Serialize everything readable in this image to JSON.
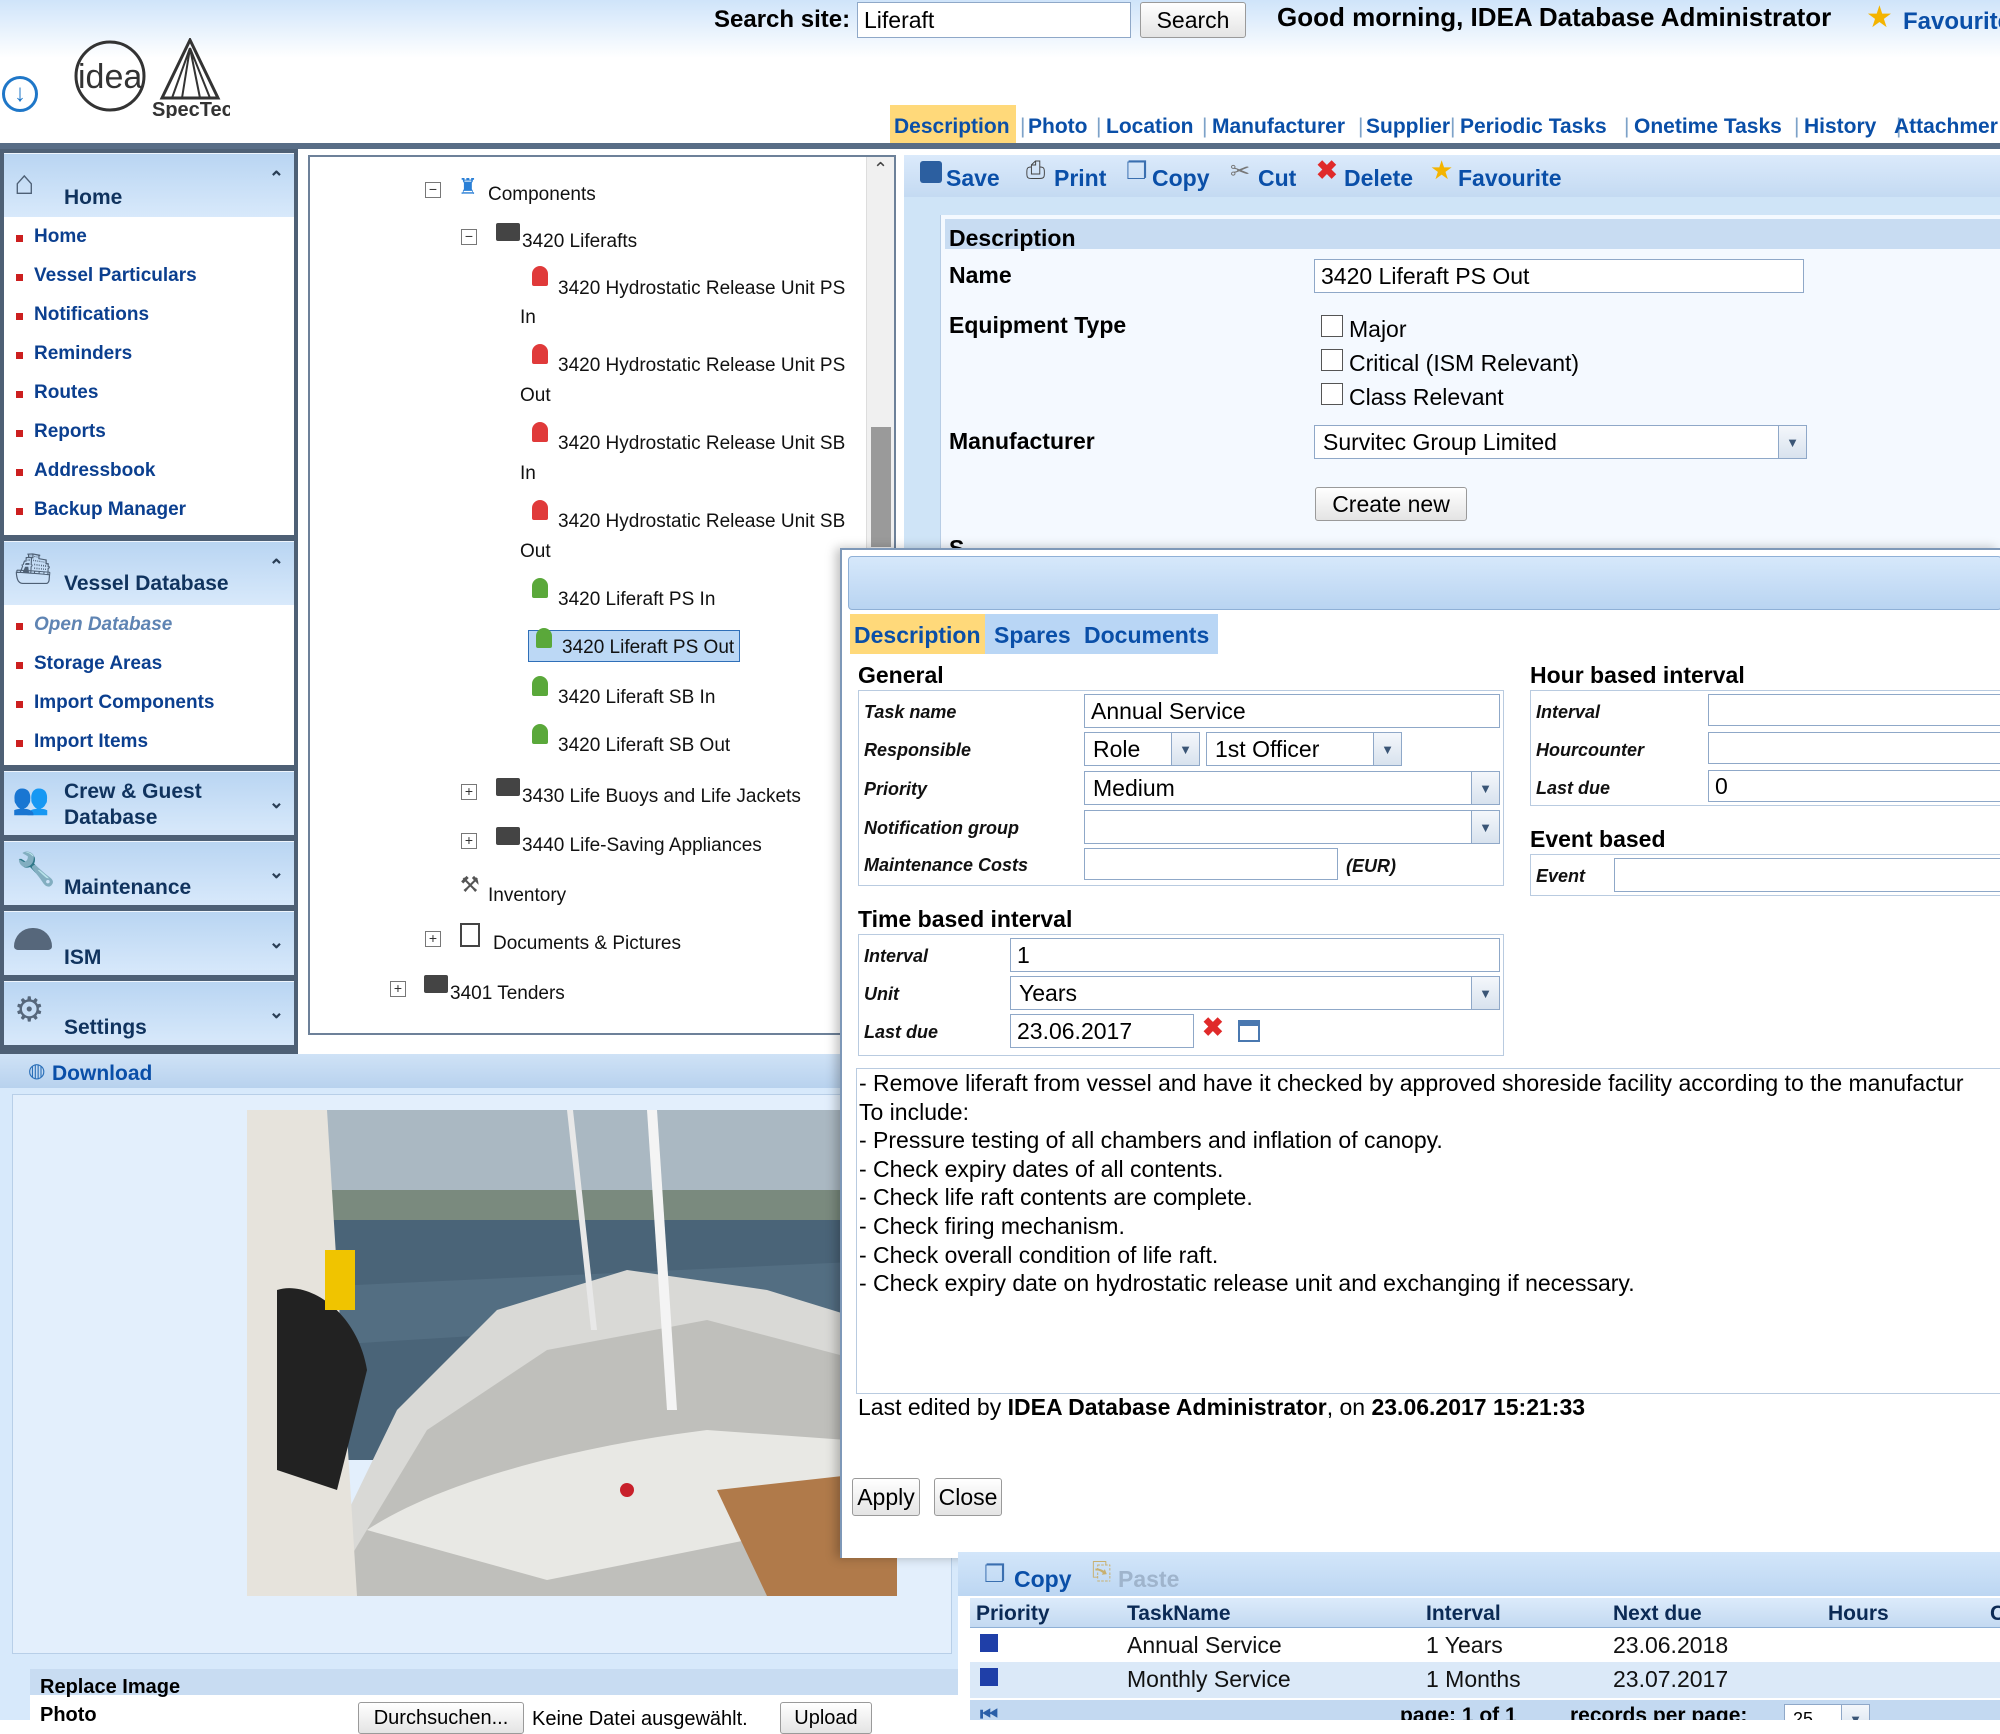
{
  "header": {
    "search_label": "Search site:",
    "search_value": "Liferaft",
    "search_button": "Search",
    "greeting": "Good morning, IDEA Database Administrator",
    "favourites": "Favourite"
  },
  "tabs": [
    "Description",
    "Photo",
    "Location",
    "Manufacturer",
    "Supplier",
    "Periodic Tasks",
    "Onetime Tasks",
    "History",
    "Attachmer"
  ],
  "sidebar": {
    "home": {
      "title": "Home",
      "items": [
        "Home",
        "Vessel Particulars",
        "Notifications",
        "Reminders",
        "Routes",
        "Reports",
        "Addressbook",
        "Backup Manager"
      ]
    },
    "vessel": {
      "title": "Vessel Database",
      "items": [
        "Open Database",
        "Storage Areas",
        "Import Components",
        "Import Items"
      ]
    },
    "crew": {
      "title_line1": "Crew & Guest",
      "title_line2": "Database"
    },
    "maintenance": {
      "title": "Maintenance"
    },
    "ism": {
      "title": "ISM"
    },
    "settings": {
      "title": "Settings"
    }
  },
  "tree": {
    "components": "Components",
    "liferafts": "3420 Liferafts",
    "hru_ps_in_1": "3420 Hydrostatic Release Unit PS",
    "hru_ps_in_2": "In",
    "hru_ps_out_1": "3420 Hydrostatic Release Unit PS",
    "hru_ps_out_2": "Out",
    "hru_sb_in_1": "3420 Hydrostatic Release Unit SB",
    "hru_sb_in_2": "In",
    "hru_sb_out_1": "3420 Hydrostatic Release Unit SB",
    "hru_sb_out_2": "Out",
    "ps_in": "3420 Liferaft PS In",
    "ps_out": "3420 Liferaft PS Out",
    "sb_in": "3420 Liferaft SB In",
    "sb_out": "3420 Liferaft SB Out",
    "buoys": "3430 Life Buoys and Life Jackets",
    "lsa": "3440 Life-Saving Appliances",
    "inventory": "Inventory",
    "docs": "Documents & Pictures",
    "tenders": "3401 Tenders"
  },
  "toolbar": {
    "save": "Save",
    "print": "Print",
    "copy": "Copy",
    "cut": "Cut",
    "delete": "Delete",
    "favourite": "Favourite"
  },
  "description": {
    "section": "Description",
    "name_label": "Name",
    "name_value": "3420 Liferaft PS Out",
    "equip_label": "Equipment Type",
    "major": "Major",
    "critical": "Critical (ISM Relevant)",
    "class_relevant": "Class Relevant",
    "manufacturer_label": "Manufacturer",
    "manufacturer_value": "Survitec Group Limited",
    "create_new": "Create new",
    "supplier_partial": "S"
  },
  "dialog": {
    "tabs": [
      "Description",
      "Spares",
      "Documents"
    ],
    "general": "General",
    "task_name_label": "Task name",
    "task_name_value": "Annual Service",
    "responsible_label": "Responsible",
    "responsible_type": "Role",
    "responsible_value": "1st Officer",
    "priority_label": "Priority",
    "priority_value": "Medium",
    "notification_label": "Notification group",
    "costs_label": "Maintenance Costs",
    "costs_unit": "(EUR)",
    "hour_based": "Hour based interval",
    "hb_interval_label": "Interval",
    "hourcounter_label": "Hourcounter",
    "hb_last_due_label": "Last due",
    "hb_last_due_value": "0",
    "event_based": "Event based",
    "event_label": "Event",
    "time_based": "Time based interval",
    "tb_interval_label": "Interval",
    "tb_interval_value": "1",
    "unit_label": "Unit",
    "unit_value": "Years",
    "tb_last_due_label": "Last due",
    "tb_last_due_value": "23.06.2017",
    "notes": [
      "- Remove liferaft from vessel and have it checked by approved shoreside facility according to the manufactur",
      "To include:",
      "- Pressure testing of all chambers and inflation of canopy.",
      "-  Check expiry dates of all contents.",
      "- Check life raft contents are complete.",
      "- Check firing mechanism.",
      "- Check overall condition of life raft.",
      "- Check expiry date on hydrostatic release unit and exchanging if necessary."
    ],
    "edited_prefix": "Last edited by ",
    "edited_user": "IDEA Database Administrator",
    "edited_mid": ", on ",
    "edited_date": "23.06.2017 15:21:33",
    "apply": "Apply",
    "close": "Close"
  },
  "photo": {
    "download": "Download",
    "replace_image": "Replace Image",
    "photo_label": "Photo",
    "browse": "Durchsuchen...",
    "no_file": "Keine Datei ausgewählt.",
    "upload": "Upload"
  },
  "tasks": {
    "copy": "Copy",
    "paste": "Paste",
    "columns": [
      "Priority",
      "TaskName",
      "Interval",
      "Next due",
      "Hours",
      "C"
    ],
    "rows": [
      {
        "name": "Annual Service",
        "interval": "1 Years",
        "next_due": "23.06.2018"
      },
      {
        "name": "Monthly Service",
        "interval": "1 Months",
        "next_due": "23.07.2017"
      }
    ],
    "pager": "page: 1 of 1",
    "records_label": "records per page:",
    "records_value": "25"
  },
  "colors": {
    "link": "#0a4fa8",
    "active_tab": "#ffd97a",
    "panel": "#cfe4f7",
    "sidebar_dark": "#4e6075",
    "priority_square": "#1f3fa8"
  }
}
